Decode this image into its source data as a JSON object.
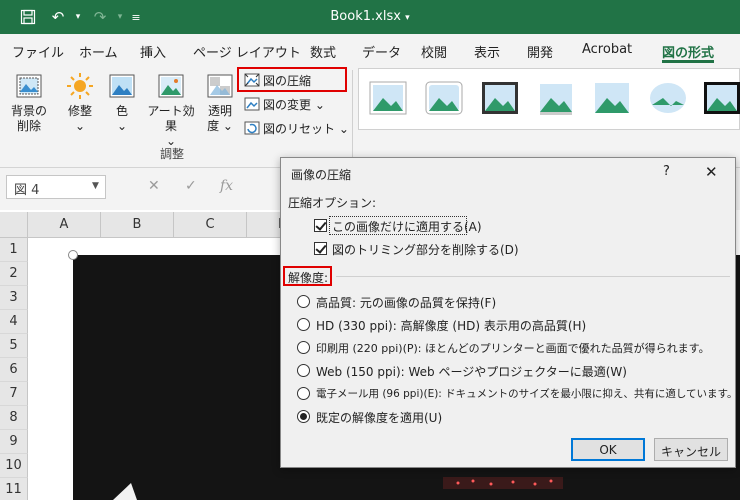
{
  "app": {
    "doc_title": "Book1.xlsx",
    "title_caret": "▾"
  },
  "tabs": [
    "ファイル",
    "ホーム",
    "挿入",
    "ページ レイアウト",
    "数式",
    "データ",
    "校閲",
    "表示",
    "開発",
    "Acrobat",
    "図の形式"
  ],
  "active_tab": "図の形式",
  "ribbon": {
    "remove_bg": [
      "背景の",
      "削除"
    ],
    "corrections": [
      "修整",
      "⌄"
    ],
    "color": [
      "色",
      "⌄"
    ],
    "artistic": [
      "アート効果",
      "⌄"
    ],
    "transparency": [
      "透明",
      "度 ⌄"
    ],
    "compress": "図の圧縮",
    "change_picture": "図の変更 ⌄",
    "reset_picture": "図のリセット ⌄",
    "group_label": "調整"
  },
  "formula_bar": {
    "name_box": "図 4",
    "cancel": "✕",
    "enter": "✓",
    "fx": "fx"
  },
  "columns": [
    "A",
    "B",
    "C",
    "D"
  ],
  "rows": [
    "1",
    "2",
    "3",
    "4",
    "5",
    "6",
    "7",
    "8",
    "9",
    "10",
    "11"
  ],
  "dialog": {
    "title": "画像の圧縮",
    "help": "?",
    "close": "✕",
    "options_heading": "圧縮オプション:",
    "check_apply_only": "この画像だけに適用する(A)",
    "check_delete_cropped": "図のトリミング部分を削除する(D)",
    "resolution_heading": "解像度:",
    "radios": [
      "高品質: 元の画像の品質を保持(F)",
      "HD (330 ppi): 高解像度 (HD) 表示用の高品質(H)",
      "印刷用 (220 ppi)(P): ほとんどのプリンターと画面で優れた品質が得られます。",
      "Web (150 ppi): Web ページやプロジェクターに最適(W)",
      "電子メール用 (96 ppi)(E): ドキュメントのサイズを最小限に抑え、共有に適しています。",
      "既定の解像度を適用(U)"
    ],
    "selected_radio": 5,
    "ok": "OK",
    "cancel": "キャンセル"
  },
  "colors": {
    "excel_green": "#217346",
    "highlight_red": "#e00000",
    "focus_blue": "#0078d7"
  }
}
